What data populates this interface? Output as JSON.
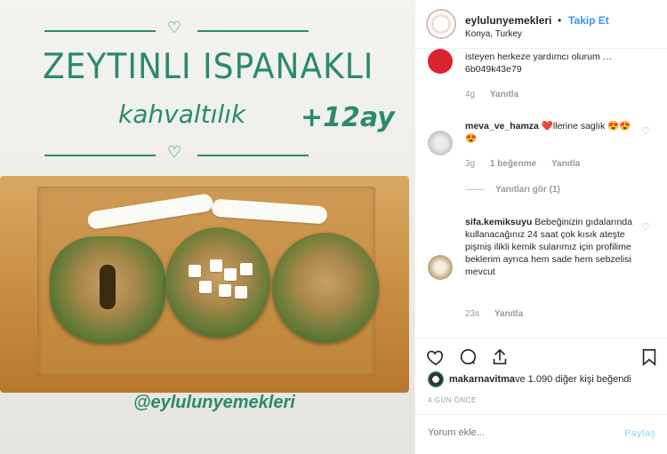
{
  "photo": {
    "title_line1": "ZEYTINLI ISPANAKLI",
    "title_line2": "kahvaltılık",
    "age_tag": "+12ay",
    "handle": "@eylulunyemekleri",
    "heart_glyph": "♡",
    "accent_color": "#2b8a6e"
  },
  "header": {
    "username": "eylulunyemekleri",
    "separator": "•",
    "follow_label": "Takip Et",
    "location": "Konya, Turkey"
  },
  "comments": [
    {
      "text_partial": "isteyen herkeze yardımcı olurum … 6b049k43e79",
      "age": "4g",
      "reply_label": "Yanıtla"
    },
    {
      "username": "meva_ve_hamza",
      "text": "❤️llerine saglık 😍😍😍",
      "age": "3g",
      "likes": "1 beğenme",
      "reply_label": "Yanıtla",
      "view_replies": "Yanıtları gör (1)"
    },
    {
      "username": "sifa.kemiksuyu",
      "text": "Bebeğinizin gıdalarında kullanacağınız 24 saat çok kısık ateşte pişmiş ilikli kemik sularımız için profilime beklerim ayrıca hem sade hem sebzelisi mevcut",
      "age": "23s",
      "reply_label": "Yanıtla"
    }
  ],
  "actions": {
    "like_icon": "heart-icon",
    "comment_icon": "comment-icon",
    "share_icon": "share-icon",
    "save_icon": "bookmark-icon"
  },
  "likes": {
    "user": "makarnavitma",
    "rest": " ve 1.090 diğer kişi beğendi"
  },
  "time": "4 GÜN ÖNCE",
  "add_comment": {
    "placeholder": "Yorum ekle...",
    "post_label": "Paylaş"
  }
}
